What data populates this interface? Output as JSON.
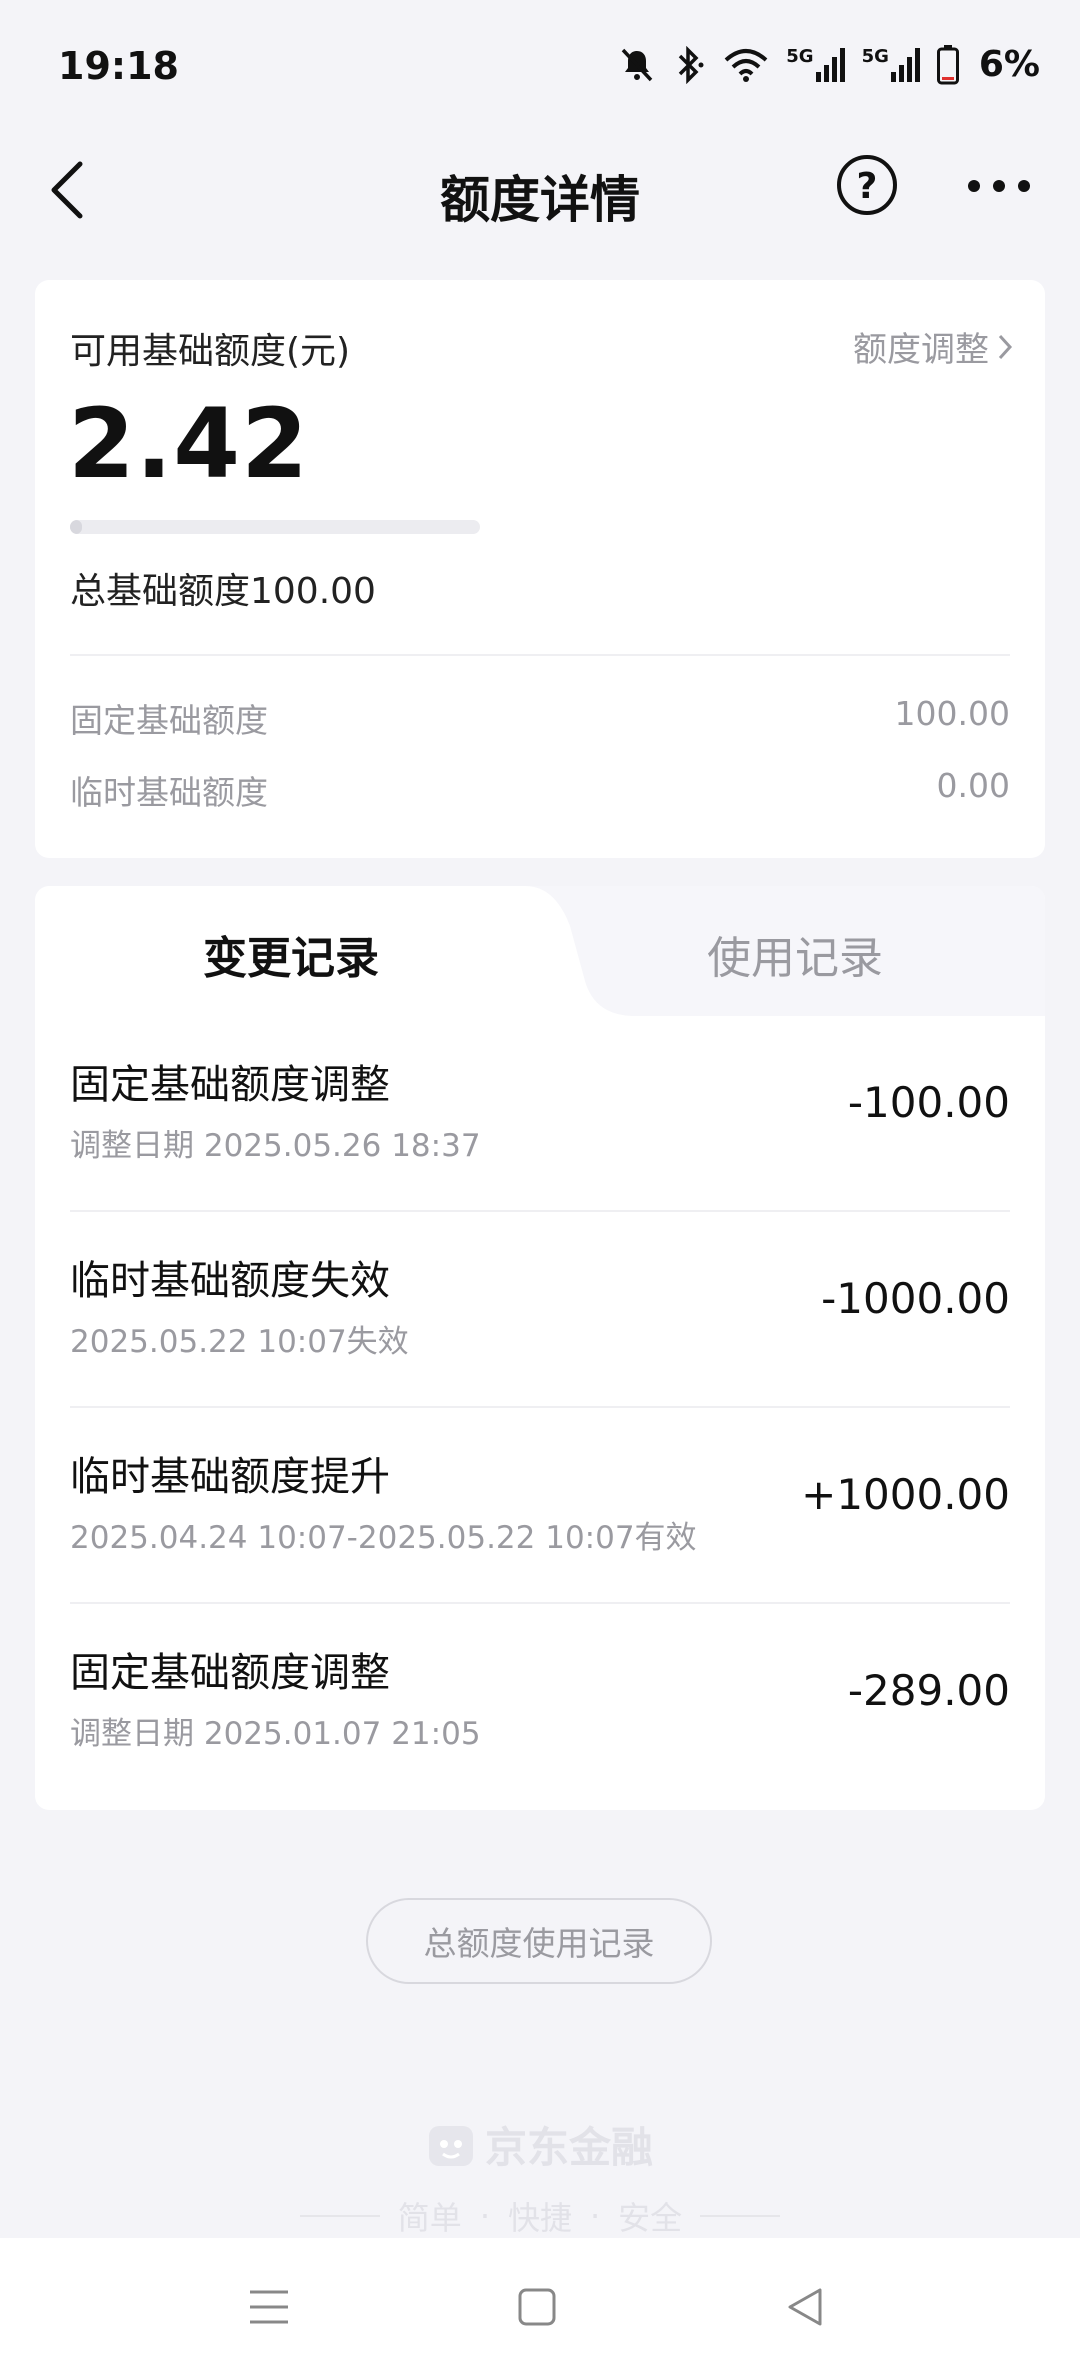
{
  "status_bar": {
    "time": "19:18",
    "signal1_label": "5G",
    "signal2_label": "5G",
    "battery": "6%"
  },
  "nav": {
    "title": "额度详情",
    "help_symbol": "?"
  },
  "credit": {
    "available_label": "可用基础额度(元)",
    "adjust_label": "额度调整",
    "available_amount": "2.42",
    "usage_fraction": 0.0242,
    "total_label": "总基础额度100.00",
    "rows": [
      {
        "label": "固定基础额度",
        "value": "100.00"
      },
      {
        "label": "临时基础额度",
        "value": "0.00"
      }
    ]
  },
  "tabs": [
    {
      "label": "变更记录",
      "active": true
    },
    {
      "label": "使用记录",
      "active": false
    }
  ],
  "records": [
    {
      "title": "固定基础额度调整",
      "subtitle": "调整日期 2025.05.26 18:37",
      "amount": "-100.00"
    },
    {
      "title": "临时基础额度失效",
      "subtitle": "2025.05.22 10:07失效",
      "amount": "-1000.00"
    },
    {
      "title": "临时基础额度提升",
      "subtitle": "2025.04.24 10:07-2025.05.22 10:07有效",
      "amount": "+1000.00"
    },
    {
      "title": "固定基础额度调整",
      "subtitle": "调整日期 2025.01.07 21:05",
      "amount": "-289.00"
    }
  ],
  "total_usage_button": "总额度使用记录",
  "brand": {
    "name": "京东金融",
    "slogan": [
      "简单",
      "·",
      "快捷",
      "·",
      "安全"
    ]
  },
  "colors": {
    "background": "#f4f4f8",
    "card": "#ffffff",
    "muted_text": "#9a9aa0",
    "battery_low": "#e0312f"
  }
}
